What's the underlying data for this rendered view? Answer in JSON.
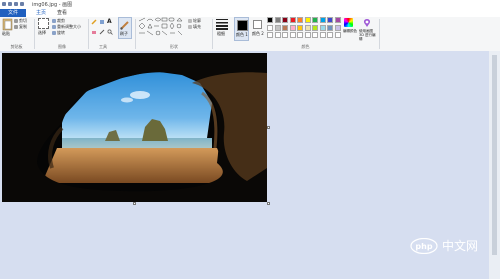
{
  "window": {
    "title": "img06.jpg - 画图"
  },
  "menu": {
    "file": "文件",
    "home": "主页",
    "view": "查看"
  },
  "clipboard": {
    "paste": "粘贴",
    "cut": "剪切",
    "copy": "复制",
    "label": "剪贴板"
  },
  "image_group": {
    "select": "选择",
    "crop": "裁剪",
    "resize": "重新调整大小",
    "rotate": "旋转",
    "label": "图像"
  },
  "tools": {
    "label": "工具",
    "text_tool": "A"
  },
  "brushes": {
    "label": "刷子"
  },
  "shapes": {
    "outline": "轮廓",
    "fill": "填充",
    "label": "形状"
  },
  "size": {
    "label": "粗细"
  },
  "colors": {
    "color1": "颜色 1",
    "color2": "颜色 2",
    "edit": "编辑颜色",
    "paint3d": "使用画图 3D 进行编辑",
    "label": "颜色",
    "palette": [
      "#000000",
      "#7f7f7f",
      "#880015",
      "#ed1c24",
      "#ff7f27",
      "#fff200",
      "#22b14c",
      "#00a2e8",
      "#3f48cc",
      "#a349a4",
      "#ffffff",
      "#c3c3c3",
      "#b97a57",
      "#ffaec9",
      "#ffc90e",
      "#efe4b0",
      "#b5e61d",
      "#99d9ea",
      "#7092be",
      "#c8bfe7",
      "#ffffff",
      "#ffffff",
      "#ffffff",
      "#ffffff",
      "#ffffff",
      "#ffffff",
      "#ffffff",
      "#ffffff",
      "#ffffff",
      "#ffffff"
    ]
  },
  "watermark": {
    "text": "中文网",
    "logo": "php"
  }
}
